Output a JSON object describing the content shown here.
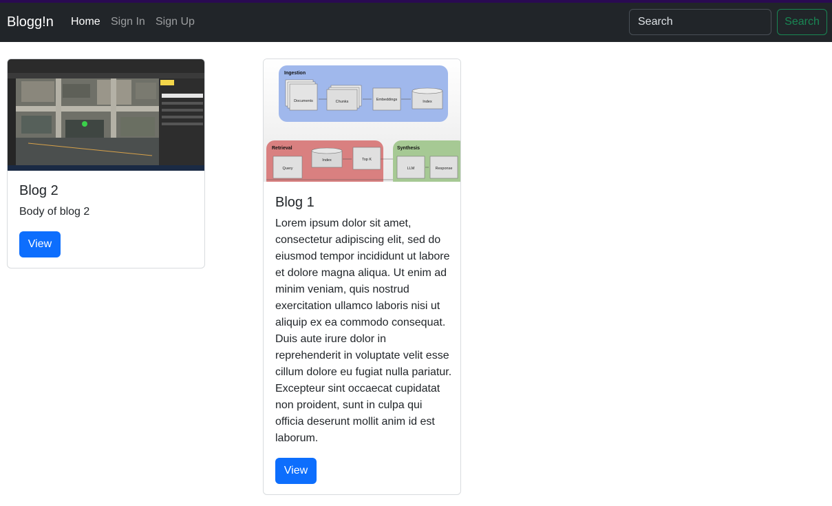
{
  "navbar": {
    "brand": "Blogg!n",
    "links": [
      {
        "label": "Home",
        "active": true
      },
      {
        "label": "Sign In",
        "active": false
      },
      {
        "label": "Sign Up",
        "active": false
      }
    ],
    "search": {
      "placeholder": "Search",
      "button_label": "Search"
    }
  },
  "cards": [
    {
      "title": "Blog 2",
      "body": "Body of blog 2",
      "button_label": "View",
      "image": "map-screenshot"
    },
    {
      "title": "Blog 1",
      "body": "Lorem ipsum dolor sit amet, consectetur adipiscing elit, sed do eiusmod tempor incididunt ut labore et dolore magna aliqua. Ut enim ad minim veniam, quis nostrud exercitation ullamco laboris nisi ut aliquip ex ea commodo consequat. Duis aute irure dolor in reprehenderit in voluptate velit esse cillum dolore eu fugiat nulla pariatur. Excepteur sint occaecat cupidatat non proident, sunt in culpa qui officia deserunt mollit anim id est laborum.",
      "button_label": "View",
      "image": "rag-pipeline-diagram",
      "diagram": {
        "ingestion": {
          "label": "Ingestion",
          "nodes": [
            "Documents",
            "Chunks",
            "Embeddings",
            "Index"
          ]
        },
        "retrieval": {
          "label": "Retrieval",
          "nodes": [
            "Query",
            "Index",
            "Top K"
          ]
        },
        "synthesis": {
          "label": "Synthesis",
          "nodes": [
            "LLM",
            "Response"
          ]
        }
      }
    }
  ],
  "colors": {
    "navbar_bg": "#212529",
    "primary": "#0d6efd",
    "success": "#198754",
    "ingestion": "#a0b8ec",
    "retrieval": "#d98080",
    "synthesis": "#a6c994"
  }
}
